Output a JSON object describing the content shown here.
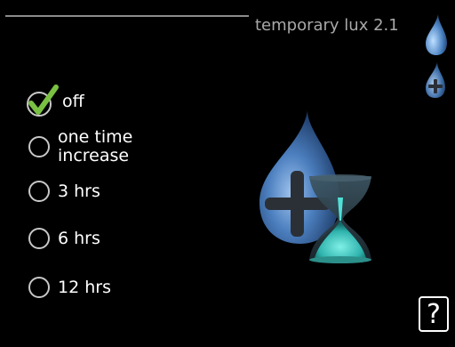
{
  "header": {
    "title": "temporary lux 2.1"
  },
  "options": [
    {
      "label": "off",
      "selected": true
    },
    {
      "label": "one time\nincrease",
      "selected": false
    },
    {
      "label": "3 hrs",
      "selected": false
    },
    {
      "label": "6 hrs",
      "selected": false
    },
    {
      "label": "12 hrs",
      "selected": false
    }
  ],
  "icons": {
    "side_top": "water-drop-icon",
    "side_bottom": "water-drop-plus-icon",
    "illustration": "hot-water-timer-icon",
    "check": "checkmark-icon"
  },
  "help": {
    "label": "?"
  },
  "colors": {
    "background": "#000000",
    "accent_drop": "#5b8fd0",
    "hourglass": "#3fc7c0",
    "check": "#7ac143"
  }
}
